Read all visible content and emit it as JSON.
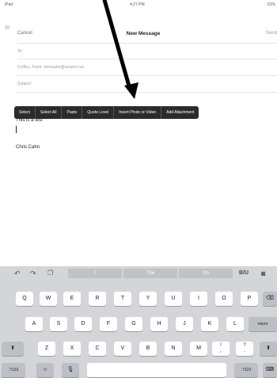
{
  "status_bar": {
    "left": "iPad",
    "time": "4:27 PM",
    "battery": "51%"
  },
  "compose": {
    "cancel_label": "Cancel",
    "title": "New Message",
    "send_label": "Send",
    "to_label": "To:",
    "cc_label": "Cc/Bcc, From: chriscahn@verizon.net",
    "subject_label": "Subject:"
  },
  "edit_menu": {
    "items": [
      "Select",
      "Select All",
      "Paste",
      "Quote Level",
      "Insert Photo or Video",
      "Add Attachment"
    ]
  },
  "body": {
    "text": "This is a test",
    "signature": "Chris Cahn"
  },
  "keyboard": {
    "predictions": [
      "I",
      "The",
      "I'm"
    ],
    "format_label": "B/U",
    "row1": [
      "Q",
      "W",
      "E",
      "R",
      "T",
      "Y",
      "U",
      "I",
      "O",
      "P"
    ],
    "row2": [
      "A",
      "S",
      "D",
      "F",
      "G",
      "H",
      "J",
      "K",
      "L"
    ],
    "return_label": "return",
    "row3": [
      "Z",
      "X",
      "C",
      "V",
      "B",
      "N",
      "M",
      "!",
      "?"
    ],
    "row3_sub": [
      ",",
      "."
    ],
    "numbers_label": ".?123"
  },
  "colors": {
    "edit_menu_bg": "#2b2b2b",
    "keyboard_bg": "#d3d5d9",
    "arrow": "#000000"
  }
}
